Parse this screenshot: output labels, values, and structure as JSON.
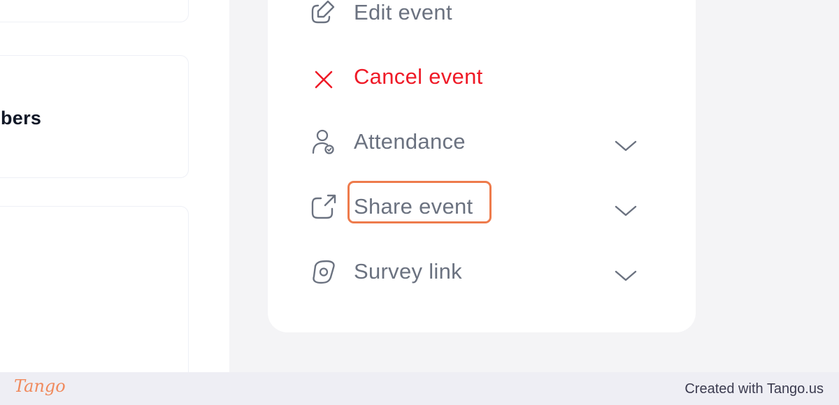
{
  "left_panel": {
    "card_title_fragment": "bers"
  },
  "event_menu": {
    "items": [
      {
        "label": "Edit event",
        "icon": "edit-pencil-icon",
        "expandable": false
      },
      {
        "label": "Cancel event",
        "icon": "close-x-icon",
        "expandable": false,
        "color": "#ef1a27"
      },
      {
        "label": "Attendance",
        "icon": "user-check-icon",
        "expandable": true
      },
      {
        "label": "Share event",
        "icon": "share-external-icon",
        "expandable": true,
        "highlighted": true
      },
      {
        "label": "Survey link",
        "icon": "survey-link-icon",
        "expandable": true
      }
    ]
  },
  "highlight_color": "#ee7b4c",
  "footer": {
    "logo": "Tango",
    "credit": "Created with Tango.us"
  }
}
